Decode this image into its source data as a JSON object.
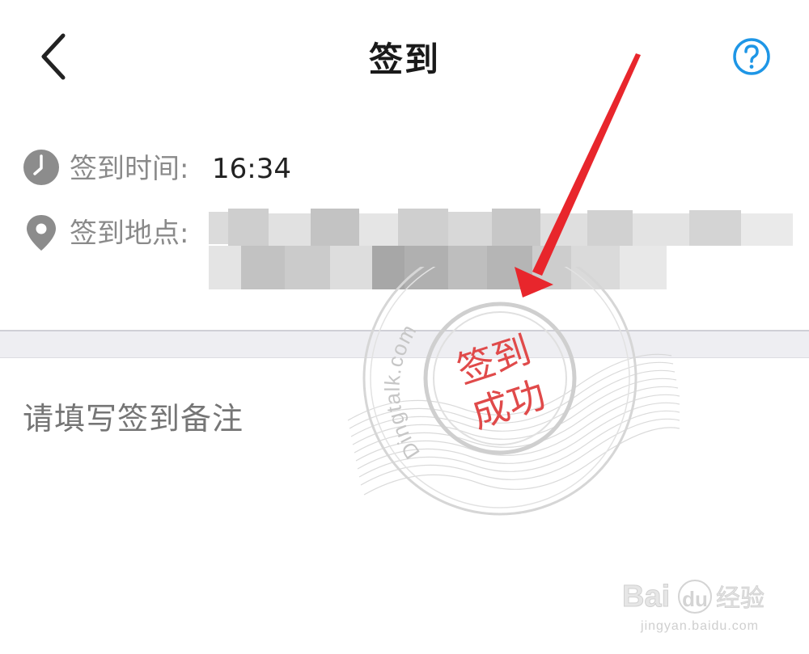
{
  "header": {
    "title": "签到",
    "back_icon": "chevron-left-icon",
    "help_icon": "question-circle-icon",
    "help_color": "#1e96e6"
  },
  "info": {
    "time": {
      "icon": "clock-icon",
      "label": "签到时间:",
      "value": "16:34"
    },
    "location": {
      "icon": "location-pin-icon",
      "label": "签到地点:",
      "value": "(blurred)"
    }
  },
  "remark": {
    "placeholder": "请填写签到备注"
  },
  "stamp": {
    "line1": "签到",
    "line2": "成功",
    "domain": "Dingtalk.com",
    "color": "#e04a4a"
  },
  "annotation": {
    "arrow_color": "#e8262c"
  },
  "watermark": {
    "brand": "Bai du 经验",
    "url": "jingyan.baidu.com"
  }
}
